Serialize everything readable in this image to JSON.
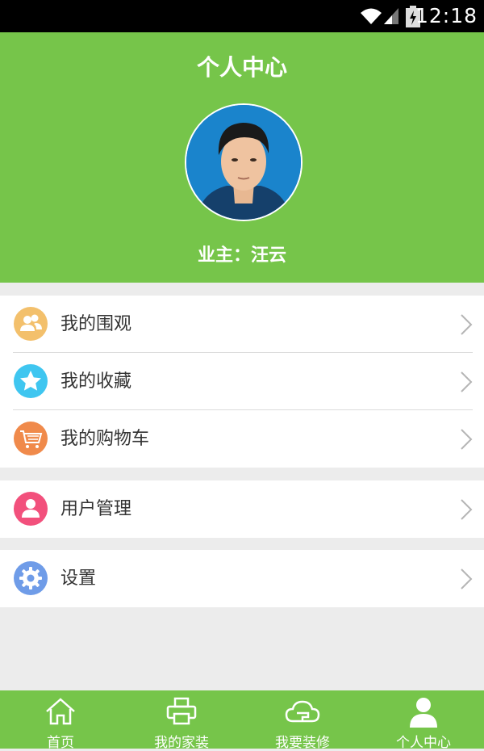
{
  "status_bar": {
    "time": "12:18",
    "icons": [
      "wifi-icon",
      "signal-icon",
      "battery-icon"
    ]
  },
  "header": {
    "title": "个人中心",
    "owner": "业主：汪云"
  },
  "menu_groups": [
    [
      {
        "label": "我的围观",
        "icon": "people-icon",
        "color": "#f3c06c"
      },
      {
        "label": "我的收藏",
        "icon": "star-icon",
        "color": "#3fc6f0"
      },
      {
        "label": "我的购物车",
        "icon": "cart-icon",
        "color": "#f08a4b"
      }
    ],
    [
      {
        "label": "用户管理",
        "icon": "user-icon",
        "color": "#f2507c"
      }
    ],
    [
      {
        "label": "设置",
        "icon": "gear-icon",
        "color": "#6f9ce8"
      }
    ]
  ],
  "tabs": [
    {
      "label": "首页",
      "icon": "home-icon"
    },
    {
      "label": "我的家装",
      "icon": "printer-icon"
    },
    {
      "label": "我要装修",
      "icon": "cloud-icon"
    },
    {
      "label": "个人中心",
      "icon": "person-icon",
      "active": true
    }
  ],
  "colors": {
    "primary": "#76c54a",
    "background": "#ececec"
  }
}
